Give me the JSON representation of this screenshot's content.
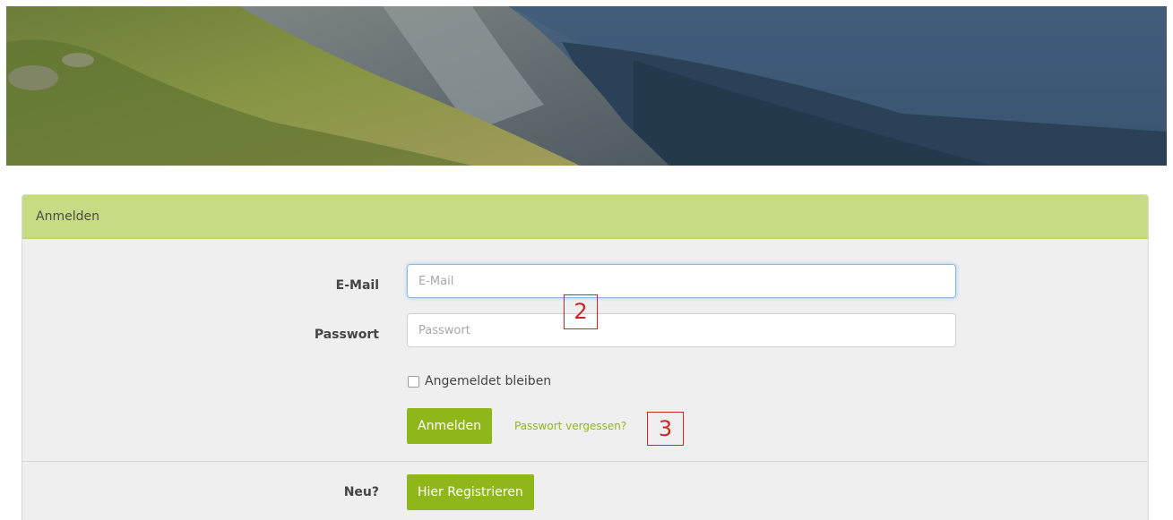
{
  "hero": {
    "description_icon": "mountain-landscape-image"
  },
  "login_panel": {
    "heading": "Anmelden",
    "email": {
      "label": "E-Mail",
      "placeholder": "E-Mail",
      "value": ""
    },
    "password": {
      "label": "Passwort",
      "placeholder": "Passwort",
      "value": ""
    },
    "remember_me": {
      "label": "Angemeldet bleiben",
      "checked": false
    },
    "submit_label": "Anmelden",
    "forgot_password_label": "Passwort vergessen?",
    "new_label": "Neu?",
    "register_label": "Hier Registrieren"
  },
  "annotations": {
    "marker_2": "2",
    "marker_3": "3"
  },
  "colors": {
    "accent": "#8fb71a",
    "heading_bg": "#c6db84",
    "panel_bg": "#efefef",
    "annotation": "#c62828"
  }
}
